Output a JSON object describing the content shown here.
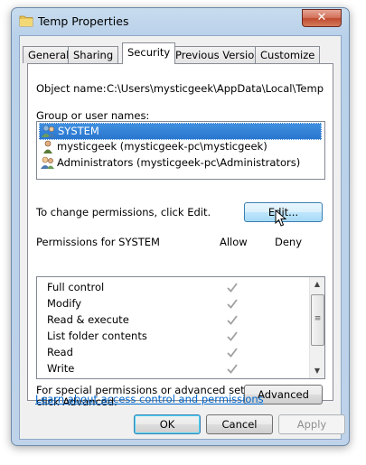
{
  "window": {
    "title": "Temp Properties",
    "close_label": "✕"
  },
  "tabs": [
    {
      "label": "General"
    },
    {
      "label": "Sharing"
    },
    {
      "label": "Security",
      "active": true
    },
    {
      "label": "Previous Versions"
    },
    {
      "label": "Customize"
    }
  ],
  "security": {
    "object_name_label": "Object name:",
    "object_name_value": "C:\\Users\\mysticgeek\\AppData\\Local\\Temp",
    "group_label": "Group or user names:",
    "users": [
      {
        "name": "SYSTEM",
        "selected": true,
        "icon": "users-group-icon"
      },
      {
        "name": "mysticgeek (mysticgeek-pc\\mysticgeek)",
        "selected": false,
        "icon": "user-icon"
      },
      {
        "name": "Administrators (mysticgeek-pc\\Administrators)",
        "selected": false,
        "icon": "users-group-icon"
      }
    ],
    "change_text": "To change permissions, click Edit.",
    "edit_button": "Edit...",
    "permissions_for": "Permissions for SYSTEM",
    "allow_header": "Allow",
    "deny_header": "Deny",
    "permissions": [
      {
        "name": "Full control",
        "allow": true,
        "deny": false
      },
      {
        "name": "Modify",
        "allow": true,
        "deny": false
      },
      {
        "name": "Read & execute",
        "allow": true,
        "deny": false
      },
      {
        "name": "List folder contents",
        "allow": true,
        "deny": false
      },
      {
        "name": "Read",
        "allow": true,
        "deny": false
      },
      {
        "name": "Write",
        "allow": true,
        "deny": false
      }
    ],
    "special_text_1": "For special permissions or advanced settings,",
    "special_text_2": "click Advanced.",
    "advanced_button": "Advanced",
    "learn_link": "Learn about access control and permissions"
  },
  "footer": {
    "ok": "OK",
    "cancel": "Cancel",
    "apply": "Apply"
  }
}
